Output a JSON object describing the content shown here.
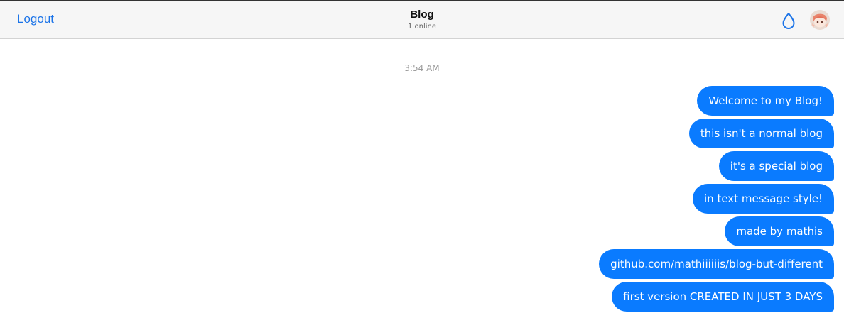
{
  "header": {
    "logout_label": "Logout",
    "title": "Blog",
    "status": "1 online",
    "theme_icon": "drop-icon",
    "accent_color": "#1a73e8"
  },
  "chat": {
    "timestamp": "3:54 AM",
    "bubble_color": "#0a7bff",
    "messages": [
      "Welcome to my Blog!",
      "this isn't a normal blog",
      "it's a special blog",
      "in text message style!",
      "made by mathis",
      "github.com/mathiiiiiis/blog-but-different",
      "first version CREATED IN JUST 3 DAYS"
    ]
  }
}
